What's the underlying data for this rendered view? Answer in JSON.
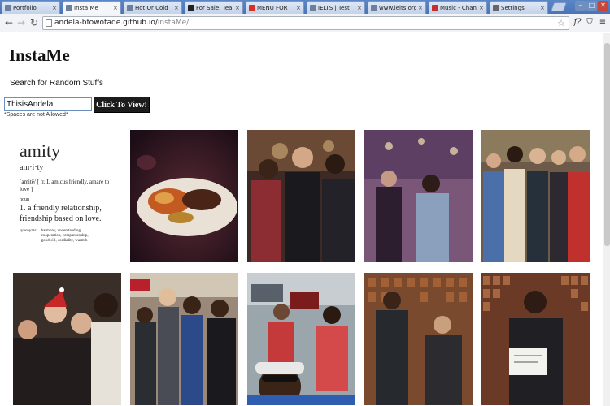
{
  "browser": {
    "tabs": [
      {
        "label": "Portfolio",
        "favicon": "page-icon",
        "color": "#6b7f9e"
      },
      {
        "label": "Insta Me",
        "favicon": "page-icon",
        "color": "#6b7f9e",
        "active": true
      },
      {
        "label": "Hot Or Cold",
        "favicon": "page-icon",
        "color": "#6b7f9e"
      },
      {
        "label": "For Sale: Tea",
        "favicon": "dark-icon",
        "color": "#222222"
      },
      {
        "label": "MENU FOR",
        "favicon": "gmail-icon",
        "color": "#d93025"
      },
      {
        "label": "IELTS | Test",
        "favicon": "page-icon",
        "color": "#6b7f9e"
      },
      {
        "label": "www.ielts.org",
        "favicon": "page-icon",
        "color": "#6b7f9e"
      },
      {
        "label": "Music - Chan",
        "favicon": "music-icon",
        "color": "#c4302b"
      },
      {
        "label": "Settings",
        "favicon": "gear-icon",
        "color": "#666666"
      }
    ],
    "address": {
      "host": "andela-bfowotade.github.io/",
      "path": "instaMe/"
    }
  },
  "page": {
    "title": "InstaMe",
    "search_label": "Search for Random Stuffs",
    "search_value": "ThisisAndela",
    "search_button": "Click To View!",
    "hint": "*Spaces are not Allowed*"
  },
  "amity_card": {
    "word": "amity",
    "pron": "am·i·ty",
    "etymology": "ˈamitē/   [ fr. L amicus friendly, amare to love ]",
    "pos": "noun",
    "definition": "1. a friendly relationship, friendship based on love.",
    "syn_label": "synonyms:",
    "synonyms": "harmony, understanding, cooperation, companionship, goodwill, cordiality, warmth"
  },
  "photos": [
    {
      "name": "amity-definition-card"
    },
    {
      "name": "food-plate-photo"
    },
    {
      "name": "three-men-photo"
    },
    {
      "name": "party-dance-photo"
    },
    {
      "name": "group-of-five-photo"
    },
    {
      "name": "christmas-group-photo"
    },
    {
      "name": "andela-women-photo"
    },
    {
      "name": "selfie-street-photo"
    },
    {
      "name": "two-men-wall-photo"
    },
    {
      "name": "man-holding-paper-photo"
    }
  ]
}
